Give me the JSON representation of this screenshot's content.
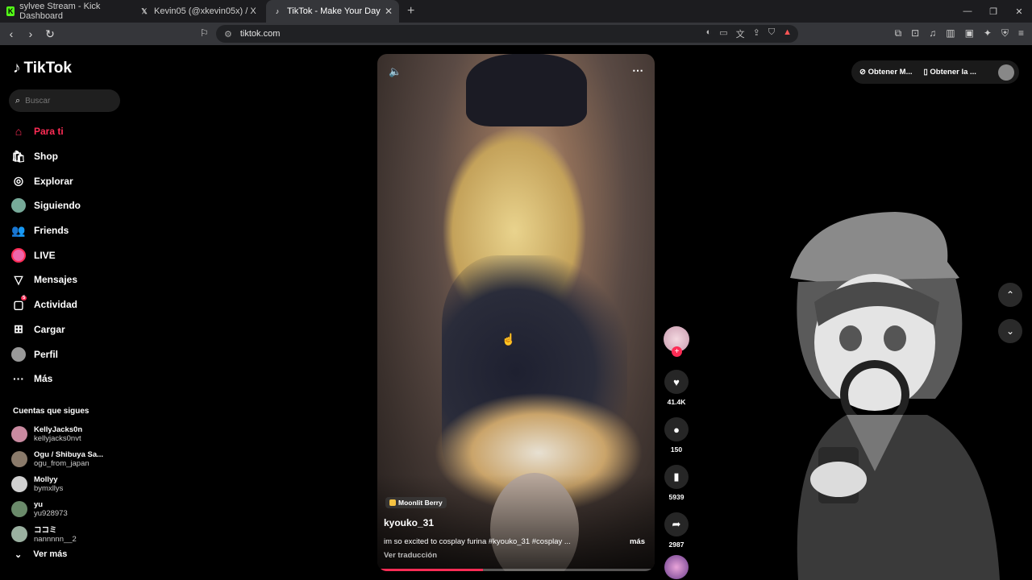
{
  "browser": {
    "tabs": [
      {
        "title": "sylvee Stream - Kick Dashboard",
        "icon": "kick-icon",
        "color": "#53fc18"
      },
      {
        "title": "Kevin05 (@xkevin05x) / X",
        "icon": "x-icon",
        "color": "#ffffff"
      },
      {
        "title": "TikTok - Make Your Day",
        "icon": "tiktok-icon",
        "color": "#ffffff"
      }
    ],
    "url": "tiktok.com",
    "notification_count": "1"
  },
  "sidebar": {
    "logo": "TikTok",
    "search_placeholder": "Buscar",
    "nav": [
      {
        "label": "Para ti",
        "icon": "home-icon"
      },
      {
        "label": "Shop",
        "icon": "shop-icon"
      },
      {
        "label": "Explorar",
        "icon": "compass-icon"
      },
      {
        "label": "Siguiendo",
        "icon": "following-avatar"
      },
      {
        "label": "Friends",
        "icon": "friends-icon"
      },
      {
        "label": "LIVE",
        "icon": "live-avatar"
      },
      {
        "label": "Mensajes",
        "icon": "messages-icon"
      },
      {
        "label": "Actividad",
        "icon": "activity-icon",
        "badge": "5"
      },
      {
        "label": "Cargar",
        "icon": "upload-icon"
      },
      {
        "label": "Perfil",
        "icon": "profile-avatar"
      },
      {
        "label": "Más",
        "icon": "more-icon"
      }
    ],
    "following_title": "Cuentas que sigues",
    "following": [
      {
        "name": "KellyJacks0n",
        "handle": "kellyjacks0nvt",
        "color": "#c98aa0"
      },
      {
        "name": "Ogu / Shibuya Sa...",
        "handle": "ogu_from_japan",
        "color": "#8a7a6a"
      },
      {
        "name": "Mollyy",
        "handle": "bymxllys",
        "color": "#d0d0d0"
      },
      {
        "name": "yu",
        "handle": "yu928973",
        "color": "#6a8a6a"
      },
      {
        "name": "ココミ",
        "handle": "nannnnn__2",
        "color": "#9ab0a0"
      }
    ],
    "see_more": "Ver más"
  },
  "video": {
    "music": "Moonlit Berry",
    "author": "kyouko_31",
    "caption": "im so excited to cosplay furina #kyouko_31 #cosplay ...",
    "more": "más",
    "translate": "Ver traducción",
    "progress": 0.38
  },
  "actions": {
    "likes": "41.4K",
    "comments": "150",
    "saves": "5939",
    "shares": "2987"
  },
  "topbar": {
    "get_coins": "Obtener M...",
    "get_app": "Obtener la ..."
  },
  "colors": {
    "accent": "#fe2c55",
    "background": "#000000"
  }
}
